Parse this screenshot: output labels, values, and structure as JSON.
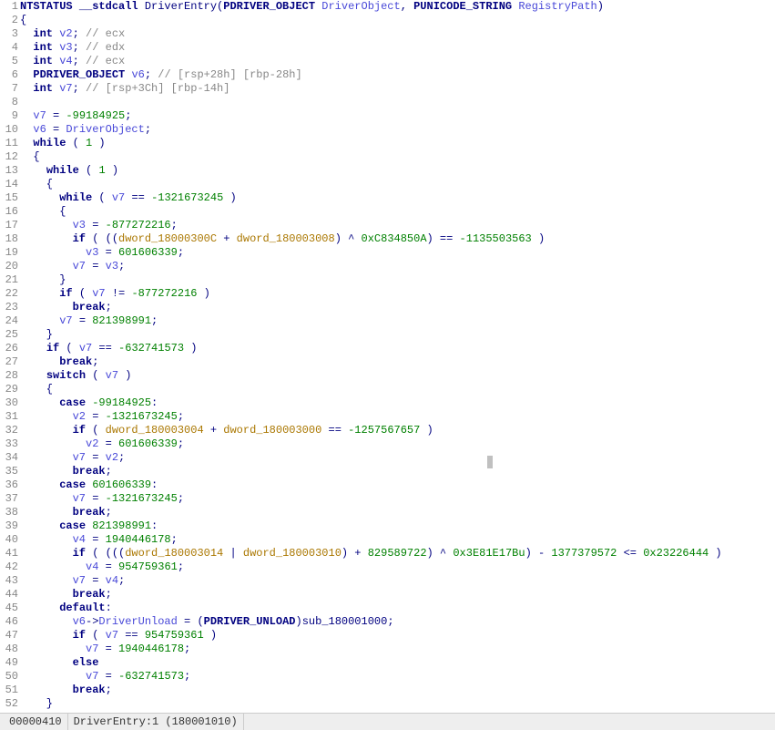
{
  "status": {
    "offset": "00000410",
    "loc": "DriverEntry:1 (180001010)"
  },
  "lines": [
    {
      "n": 1,
      "tokens": [
        [
          "type",
          "NTSTATUS "
        ],
        [
          "kw",
          "__stdcall "
        ],
        [
          "fname",
          "DriverEntry"
        ],
        [
          "punct",
          "("
        ],
        [
          "type",
          "PDRIVER_OBJECT "
        ],
        [
          "id",
          "DriverObject"
        ],
        [
          "punct",
          ", "
        ],
        [
          "type",
          "PUNICODE_STRING "
        ],
        [
          "id",
          "RegistryPath"
        ],
        [
          "punct",
          ")"
        ]
      ]
    },
    {
      "n": 2,
      "tokens": [
        [
          "punct",
          "{"
        ]
      ]
    },
    {
      "n": 3,
      "tokens": [
        [
          "punct",
          "  "
        ],
        [
          "kw",
          "int "
        ],
        [
          "id",
          "v2"
        ],
        [
          "punct",
          "; "
        ],
        [
          "cmt",
          "// ecx"
        ]
      ]
    },
    {
      "n": 4,
      "tokens": [
        [
          "punct",
          "  "
        ],
        [
          "kw",
          "int "
        ],
        [
          "id",
          "v3"
        ],
        [
          "punct",
          "; "
        ],
        [
          "cmt",
          "// edx"
        ]
      ]
    },
    {
      "n": 5,
      "tokens": [
        [
          "punct",
          "  "
        ],
        [
          "kw",
          "int "
        ],
        [
          "id",
          "v4"
        ],
        [
          "punct",
          "; "
        ],
        [
          "cmt",
          "// ecx"
        ]
      ]
    },
    {
      "n": 6,
      "tokens": [
        [
          "punct",
          "  "
        ],
        [
          "type",
          "PDRIVER_OBJECT "
        ],
        [
          "id",
          "v6"
        ],
        [
          "punct",
          "; "
        ],
        [
          "cmt",
          "// [rsp+28h] [rbp-28h]"
        ]
      ]
    },
    {
      "n": 7,
      "tokens": [
        [
          "punct",
          "  "
        ],
        [
          "kw",
          "int "
        ],
        [
          "id",
          "v7"
        ],
        [
          "punct",
          "; "
        ],
        [
          "cmt",
          "// [rsp+3Ch] [rbp-14h]"
        ]
      ]
    },
    {
      "n": 8,
      "tokens": [
        [
          "punct",
          ""
        ]
      ]
    },
    {
      "n": 9,
      "tokens": [
        [
          "punct",
          "  "
        ],
        [
          "id",
          "v7"
        ],
        [
          "punct",
          " = "
        ],
        [
          "num",
          "-99184925"
        ],
        [
          "punct",
          ";"
        ]
      ]
    },
    {
      "n": 10,
      "tokens": [
        [
          "punct",
          "  "
        ],
        [
          "id",
          "v6"
        ],
        [
          "punct",
          " = "
        ],
        [
          "id",
          "DriverObject"
        ],
        [
          "punct",
          ";"
        ]
      ]
    },
    {
      "n": 11,
      "tokens": [
        [
          "punct",
          "  "
        ],
        [
          "kw",
          "while"
        ],
        [
          "punct",
          " ( "
        ],
        [
          "num",
          "1"
        ],
        [
          "punct",
          " )"
        ]
      ]
    },
    {
      "n": 12,
      "tokens": [
        [
          "punct",
          "  {"
        ]
      ]
    },
    {
      "n": 13,
      "tokens": [
        [
          "punct",
          "    "
        ],
        [
          "kw",
          "while"
        ],
        [
          "punct",
          " ( "
        ],
        [
          "num",
          "1"
        ],
        [
          "punct",
          " )"
        ]
      ]
    },
    {
      "n": 14,
      "tokens": [
        [
          "punct",
          "    {"
        ]
      ]
    },
    {
      "n": 15,
      "tokens": [
        [
          "punct",
          "      "
        ],
        [
          "kw",
          "while"
        ],
        [
          "punct",
          " ( "
        ],
        [
          "id",
          "v7"
        ],
        [
          "punct",
          " == "
        ],
        [
          "num",
          "-1321673245"
        ],
        [
          "punct",
          " )"
        ]
      ]
    },
    {
      "n": 16,
      "tokens": [
        [
          "punct",
          "      {"
        ]
      ]
    },
    {
      "n": 17,
      "tokens": [
        [
          "punct",
          "        "
        ],
        [
          "id",
          "v3"
        ],
        [
          "punct",
          " = "
        ],
        [
          "num",
          "-877272216"
        ],
        [
          "punct",
          ";"
        ]
      ]
    },
    {
      "n": 18,
      "tokens": [
        [
          "punct",
          "        "
        ],
        [
          "kw",
          "if"
        ],
        [
          "punct",
          " ( (("
        ],
        [
          "gvar",
          "dword_18000300C"
        ],
        [
          "punct",
          " + "
        ],
        [
          "gvar",
          "dword_180003008"
        ],
        [
          "punct",
          ") ^ "
        ],
        [
          "num",
          "0xC834850A"
        ],
        [
          "punct",
          ") == "
        ],
        [
          "num",
          "-1135503563"
        ],
        [
          "punct",
          " )"
        ]
      ]
    },
    {
      "n": 19,
      "tokens": [
        [
          "punct",
          "          "
        ],
        [
          "id",
          "v3"
        ],
        [
          "punct",
          " = "
        ],
        [
          "num",
          "601606339"
        ],
        [
          "punct",
          ";"
        ]
      ]
    },
    {
      "n": 20,
      "tokens": [
        [
          "punct",
          "        "
        ],
        [
          "id",
          "v7"
        ],
        [
          "punct",
          " = "
        ],
        [
          "id",
          "v3"
        ],
        [
          "punct",
          ";"
        ]
      ]
    },
    {
      "n": 21,
      "tokens": [
        [
          "punct",
          "      }"
        ]
      ]
    },
    {
      "n": 22,
      "tokens": [
        [
          "punct",
          "      "
        ],
        [
          "kw",
          "if"
        ],
        [
          "punct",
          " ( "
        ],
        [
          "id",
          "v7"
        ],
        [
          "punct",
          " != "
        ],
        [
          "num",
          "-877272216"
        ],
        [
          "punct",
          " )"
        ]
      ]
    },
    {
      "n": 23,
      "tokens": [
        [
          "punct",
          "        "
        ],
        [
          "kw",
          "break"
        ],
        [
          "punct",
          ";"
        ]
      ]
    },
    {
      "n": 24,
      "tokens": [
        [
          "punct",
          "      "
        ],
        [
          "id",
          "v7"
        ],
        [
          "punct",
          " = "
        ],
        [
          "num",
          "821398991"
        ],
        [
          "punct",
          ";"
        ]
      ]
    },
    {
      "n": 25,
      "tokens": [
        [
          "punct",
          "    }"
        ]
      ]
    },
    {
      "n": 26,
      "tokens": [
        [
          "punct",
          "    "
        ],
        [
          "kw",
          "if"
        ],
        [
          "punct",
          " ( "
        ],
        [
          "id",
          "v7"
        ],
        [
          "punct",
          " == "
        ],
        [
          "num",
          "-632741573"
        ],
        [
          "punct",
          " )"
        ]
      ]
    },
    {
      "n": 27,
      "tokens": [
        [
          "punct",
          "      "
        ],
        [
          "kw",
          "break"
        ],
        [
          "punct",
          ";"
        ]
      ]
    },
    {
      "n": 28,
      "tokens": [
        [
          "punct",
          "    "
        ],
        [
          "kw",
          "switch"
        ],
        [
          "punct",
          " ( "
        ],
        [
          "id",
          "v7"
        ],
        [
          "punct",
          " )"
        ]
      ]
    },
    {
      "n": 29,
      "tokens": [
        [
          "punct",
          "    {"
        ]
      ]
    },
    {
      "n": 30,
      "tokens": [
        [
          "punct",
          "      "
        ],
        [
          "kw",
          "case"
        ],
        [
          "punct",
          " "
        ],
        [
          "num",
          "-99184925"
        ],
        [
          "punct",
          ":"
        ]
      ]
    },
    {
      "n": 31,
      "tokens": [
        [
          "punct",
          "        "
        ],
        [
          "id",
          "v2"
        ],
        [
          "punct",
          " = "
        ],
        [
          "num",
          "-1321673245"
        ],
        [
          "punct",
          ";"
        ]
      ]
    },
    {
      "n": 32,
      "tokens": [
        [
          "punct",
          "        "
        ],
        [
          "kw",
          "if"
        ],
        [
          "punct",
          " ( "
        ],
        [
          "gvar",
          "dword_180003004"
        ],
        [
          "punct",
          " + "
        ],
        [
          "gvar",
          "dword_180003000"
        ],
        [
          "punct",
          " == "
        ],
        [
          "num",
          "-1257567657"
        ],
        [
          "punct",
          " )"
        ]
      ]
    },
    {
      "n": 33,
      "tokens": [
        [
          "punct",
          "          "
        ],
        [
          "id",
          "v2"
        ],
        [
          "punct",
          " = "
        ],
        [
          "num",
          "601606339"
        ],
        [
          "punct",
          ";"
        ]
      ]
    },
    {
      "n": 34,
      "tokens": [
        [
          "punct",
          "        "
        ],
        [
          "id",
          "v7"
        ],
        [
          "punct",
          " = "
        ],
        [
          "id",
          "v2"
        ],
        [
          "punct",
          ";"
        ]
      ]
    },
    {
      "n": 35,
      "tokens": [
        [
          "punct",
          "        "
        ],
        [
          "kw",
          "break"
        ],
        [
          "punct",
          ";"
        ]
      ]
    },
    {
      "n": 36,
      "tokens": [
        [
          "punct",
          "      "
        ],
        [
          "kw",
          "case"
        ],
        [
          "punct",
          " "
        ],
        [
          "num",
          "601606339"
        ],
        [
          "punct",
          ":"
        ]
      ]
    },
    {
      "n": 37,
      "tokens": [
        [
          "punct",
          "        "
        ],
        [
          "id",
          "v7"
        ],
        [
          "punct",
          " = "
        ],
        [
          "num",
          "-1321673245"
        ],
        [
          "punct",
          ";"
        ]
      ]
    },
    {
      "n": 38,
      "tokens": [
        [
          "punct",
          "        "
        ],
        [
          "kw",
          "break"
        ],
        [
          "punct",
          ";"
        ]
      ]
    },
    {
      "n": 39,
      "tokens": [
        [
          "punct",
          "      "
        ],
        [
          "kw",
          "case"
        ],
        [
          "punct",
          " "
        ],
        [
          "num",
          "821398991"
        ],
        [
          "punct",
          ":"
        ]
      ]
    },
    {
      "n": 40,
      "tokens": [
        [
          "punct",
          "        "
        ],
        [
          "id",
          "v4"
        ],
        [
          "punct",
          " = "
        ],
        [
          "num",
          "1940446178"
        ],
        [
          "punct",
          ";"
        ]
      ]
    },
    {
      "n": 41,
      "tokens": [
        [
          "punct",
          "        "
        ],
        [
          "kw",
          "if"
        ],
        [
          "punct",
          " ( ((("
        ],
        [
          "gvar",
          "dword_180003014"
        ],
        [
          "punct",
          " | "
        ],
        [
          "gvar",
          "dword_180003010"
        ],
        [
          "punct",
          ") + "
        ],
        [
          "num",
          "829589722"
        ],
        [
          "punct",
          ") ^ "
        ],
        [
          "num",
          "0x3E81E17Bu"
        ],
        [
          "punct",
          ") - "
        ],
        [
          "num",
          "1377379572"
        ],
        [
          "punct",
          " <= "
        ],
        [
          "num",
          "0x23226444"
        ],
        [
          "punct",
          " )"
        ]
      ]
    },
    {
      "n": 42,
      "tokens": [
        [
          "punct",
          "          "
        ],
        [
          "id",
          "v4"
        ],
        [
          "punct",
          " = "
        ],
        [
          "num",
          "954759361"
        ],
        [
          "punct",
          ";"
        ]
      ]
    },
    {
      "n": 43,
      "tokens": [
        [
          "punct",
          "        "
        ],
        [
          "id",
          "v7"
        ],
        [
          "punct",
          " = "
        ],
        [
          "id",
          "v4"
        ],
        [
          "punct",
          ";"
        ]
      ]
    },
    {
      "n": 44,
      "tokens": [
        [
          "punct",
          "        "
        ],
        [
          "kw",
          "break"
        ],
        [
          "punct",
          ";"
        ]
      ]
    },
    {
      "n": 45,
      "tokens": [
        [
          "punct",
          "      "
        ],
        [
          "kw",
          "default"
        ],
        [
          "punct",
          ":"
        ]
      ]
    },
    {
      "n": 46,
      "tokens": [
        [
          "punct",
          "        "
        ],
        [
          "id",
          "v6"
        ],
        [
          "punct",
          "->"
        ],
        [
          "id",
          "DriverUnload"
        ],
        [
          "punct",
          " = ("
        ],
        [
          "type",
          "PDRIVER_UNLOAD"
        ],
        [
          "punct",
          ")"
        ],
        [
          "fname",
          "sub_180001000"
        ],
        [
          "punct",
          ";"
        ]
      ]
    },
    {
      "n": 47,
      "tokens": [
        [
          "punct",
          "        "
        ],
        [
          "kw",
          "if"
        ],
        [
          "punct",
          " ( "
        ],
        [
          "id",
          "v7"
        ],
        [
          "punct",
          " == "
        ],
        [
          "num",
          "954759361"
        ],
        [
          "punct",
          " )"
        ]
      ]
    },
    {
      "n": 48,
      "tokens": [
        [
          "punct",
          "          "
        ],
        [
          "id",
          "v7"
        ],
        [
          "punct",
          " = "
        ],
        [
          "num",
          "1940446178"
        ],
        [
          "punct",
          ";"
        ]
      ]
    },
    {
      "n": 49,
      "tokens": [
        [
          "punct",
          "        "
        ],
        [
          "kw",
          "else"
        ]
      ]
    },
    {
      "n": 50,
      "tokens": [
        [
          "punct",
          "          "
        ],
        [
          "id",
          "v7"
        ],
        [
          "punct",
          " = "
        ],
        [
          "num",
          "-632741573"
        ],
        [
          "punct",
          ";"
        ]
      ]
    },
    {
      "n": 51,
      "tokens": [
        [
          "punct",
          "        "
        ],
        [
          "kw",
          "break"
        ],
        [
          "punct",
          ";"
        ]
      ]
    },
    {
      "n": 52,
      "tokens": [
        [
          "punct",
          "    }"
        ]
      ]
    }
  ]
}
